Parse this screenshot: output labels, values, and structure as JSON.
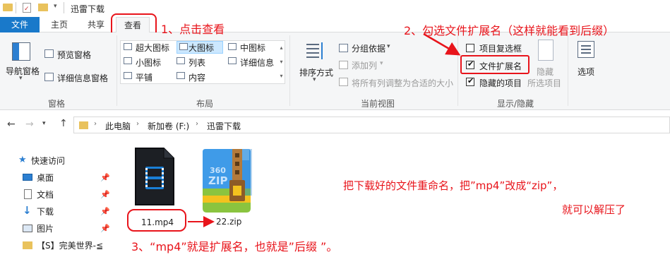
{
  "window": {
    "title": "迅雷下载"
  },
  "tabs": [
    {
      "label": "文件"
    },
    {
      "label": "主页"
    },
    {
      "label": "共享"
    },
    {
      "label": "查看"
    }
  ],
  "ribbon": {
    "panes": {
      "nav_pane": "导航窗格",
      "preview_pane": "预览窗格",
      "details_pane": "详细信息窗格",
      "group_label": "窗格"
    },
    "layout": {
      "extra_large": "超大图标",
      "large": "大图标",
      "medium": "中图标",
      "small": "小图标",
      "list": "列表",
      "details": "详细信息",
      "tiles": "平铺",
      "content": "内容",
      "group_label": "布局"
    },
    "current_view": {
      "sort_by": "排序方式",
      "group_by": "分组依据",
      "add_columns": "添加列",
      "size_all_columns": "将所有列调整为合适的大小",
      "group_label": "当前视图"
    },
    "show_hide": {
      "item_checkboxes": "项目复选框",
      "item_checkboxes_checked": false,
      "file_name_extensions": "文件扩展名",
      "file_name_extensions_checked": true,
      "hidden_items": "隐藏的项目",
      "hidden_items_checked": true,
      "hide": "隐藏",
      "selected_items": "所选项目",
      "group_label": "显示/隐藏"
    },
    "options": "选项"
  },
  "address": {
    "crumbs": [
      "此电脑",
      "新加卷 (F:)",
      "迅雷下载"
    ]
  },
  "nav": {
    "items": [
      {
        "label": "快速访问"
      },
      {
        "label": "桌面"
      },
      {
        "label": "文档"
      },
      {
        "label": "下载"
      },
      {
        "label": "图片"
      },
      {
        "label": "【S】完美世界-≦"
      }
    ]
  },
  "files": [
    {
      "name": "11.mp4",
      "badge": ""
    },
    {
      "name": "22.zip",
      "badge": "360\nZIP"
    }
  ],
  "zip_badge_line1": "360",
  "zip_badge_line2": "ZIP",
  "annotations": {
    "step1": "1、点击查看",
    "step2": "2、勾选文件扩展名（这样就能看到后缀）",
    "note1": "把下载好的文件重命名，把”mp4”改成“zip”，",
    "note2": "就可以解压了",
    "step3": "3、“mp4”就是扩展名，也就是”后缀 ”。"
  },
  "colors": {
    "annotation": "#e8141b",
    "file_tab": "#1979ca",
    "accent_select": "#cce8ff"
  }
}
